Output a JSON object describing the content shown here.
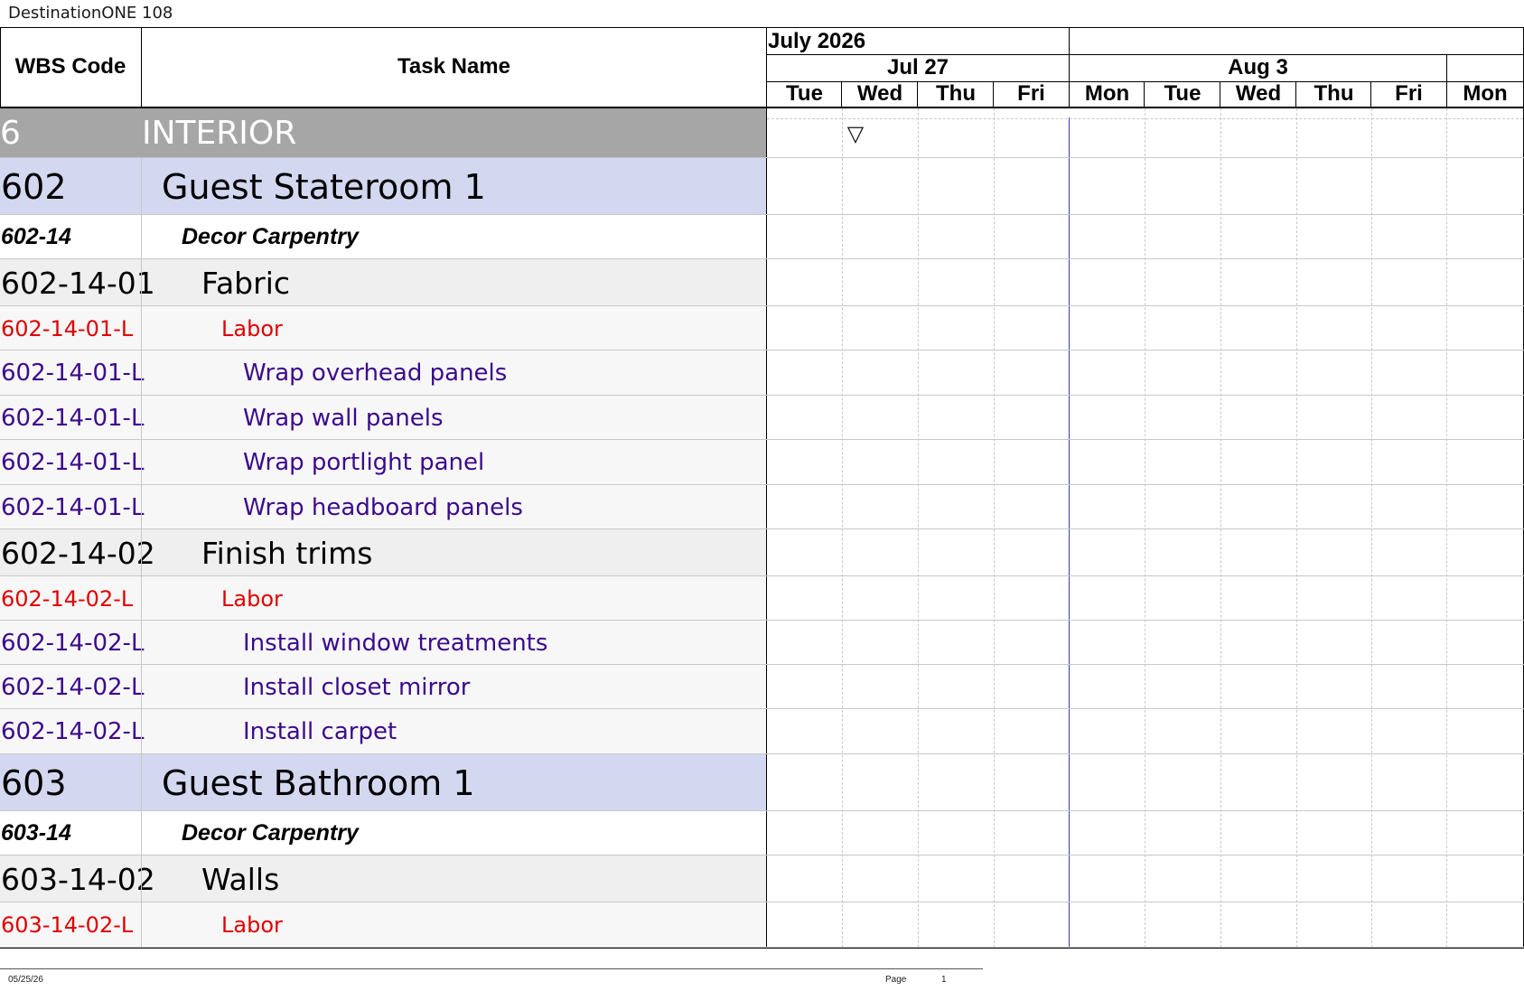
{
  "app": {
    "title": "DestinationONE 108"
  },
  "columns": {
    "wbs": "WBS Code",
    "task": "Task Name"
  },
  "timeline": {
    "month": "July 2026",
    "weeks": [
      "Jul 27",
      "Aug 3"
    ],
    "days": [
      "Tue",
      "Wed",
      "Thu",
      "Fri",
      "Mon",
      "Tue",
      "Wed",
      "Thu",
      "Fri",
      "Mon"
    ],
    "collapse_marker": "▽"
  },
  "rows": [
    {
      "level": "section",
      "wbs": "6",
      "task": "INTERIOR"
    },
    {
      "level": "room",
      "wbs": "602",
      "task": "Guest Stateroom 1"
    },
    {
      "level": "trade",
      "wbs": "602-14",
      "task": "Decor Carpentry"
    },
    {
      "level": "item",
      "wbs": "602-14-01",
      "task": "Fabric"
    },
    {
      "level": "labor",
      "wbs": "602-14-01-L",
      "task": "Labor"
    },
    {
      "level": "task",
      "wbs": "602-14-01-L",
      "task": "Wrap overhead panels"
    },
    {
      "level": "task",
      "wbs": "602-14-01-L",
      "task": "Wrap wall panels"
    },
    {
      "level": "task",
      "wbs": "602-14-01-L",
      "task": "Wrap portlight panel"
    },
    {
      "level": "task",
      "wbs": "602-14-01-L",
      "task": "Wrap headboard panels"
    },
    {
      "level": "item",
      "wbs": "602-14-02",
      "task": "Finish trims"
    },
    {
      "level": "labor",
      "wbs": "602-14-02-L",
      "task": "Labor"
    },
    {
      "level": "task",
      "wbs": "602-14-02-L",
      "task": "Install window treatments"
    },
    {
      "level": "task",
      "wbs": "602-14-02-L",
      "task": "Install closet mirror"
    },
    {
      "level": "task",
      "wbs": "602-14-02-L",
      "task": "Install carpet"
    },
    {
      "level": "room",
      "wbs": "603",
      "task": "Guest Bathroom 1"
    },
    {
      "level": "trade",
      "wbs": "603-14",
      "task": "Decor Carpentry"
    },
    {
      "level": "item",
      "wbs": "603-14-02",
      "task": "Walls"
    },
    {
      "level": "labor",
      "wbs": "603-14-02-L",
      "task": "Labor"
    }
  ],
  "footer": {
    "date": "05/25/26",
    "page_label": "Page",
    "page_number": "1"
  },
  "colors": {
    "section_bg": "#a6a6a6",
    "room_bg": "#d3d8f0",
    "labor_text": "#e00000",
    "task_text": "#3c0a8c",
    "week_boundary": "#3a3aa8"
  }
}
